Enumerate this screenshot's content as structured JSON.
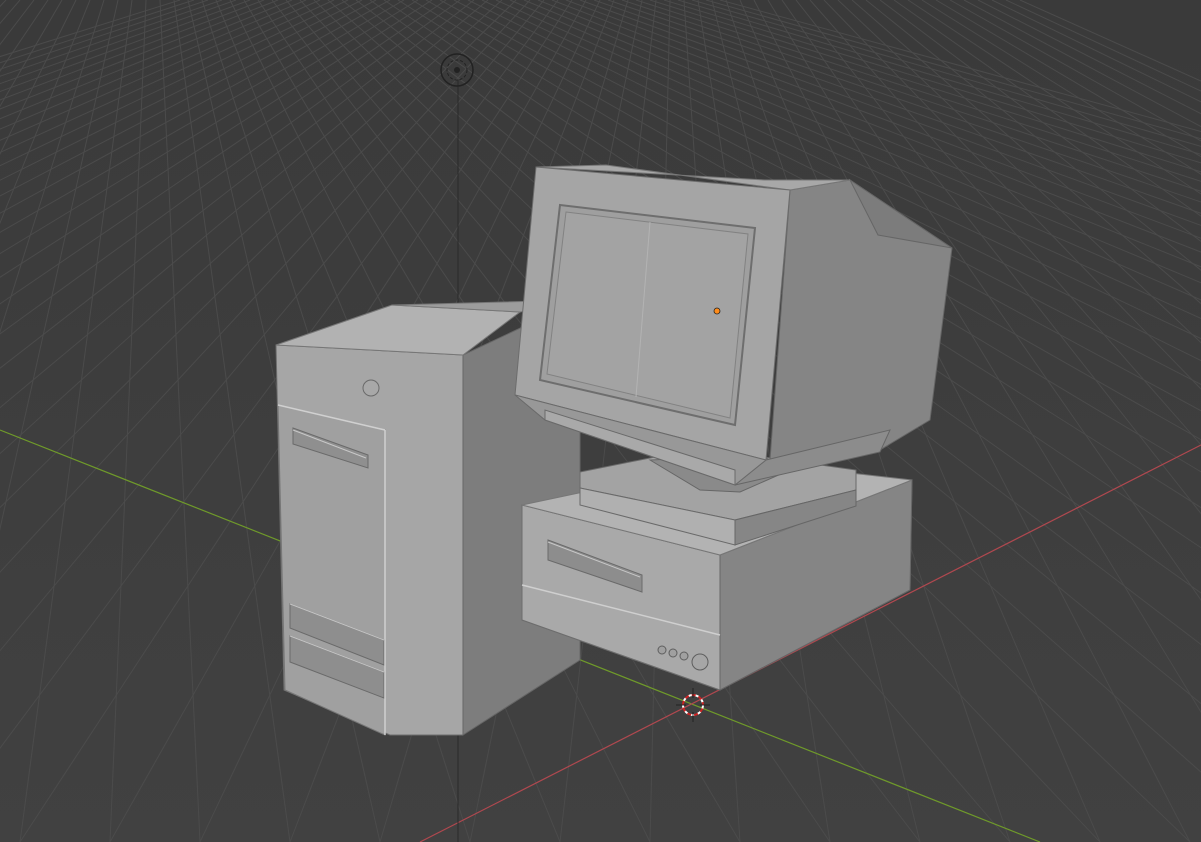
{
  "viewport": {
    "background": "#3d3d3d",
    "grid_color": "#4a4a4a",
    "x_axis_color": "#b0484f",
    "y_axis_color": "#6f9a2a",
    "z_axis_color": "#3d5ea8"
  },
  "scene": {
    "objects": [
      "computer-tower",
      "crt-monitor",
      "desktop-case"
    ],
    "mesh_color": "#9a9a9a",
    "origin_marker_color": "#ff8c1a",
    "light_icon": "light-icon",
    "cursor_icon": "3d-cursor-icon"
  }
}
